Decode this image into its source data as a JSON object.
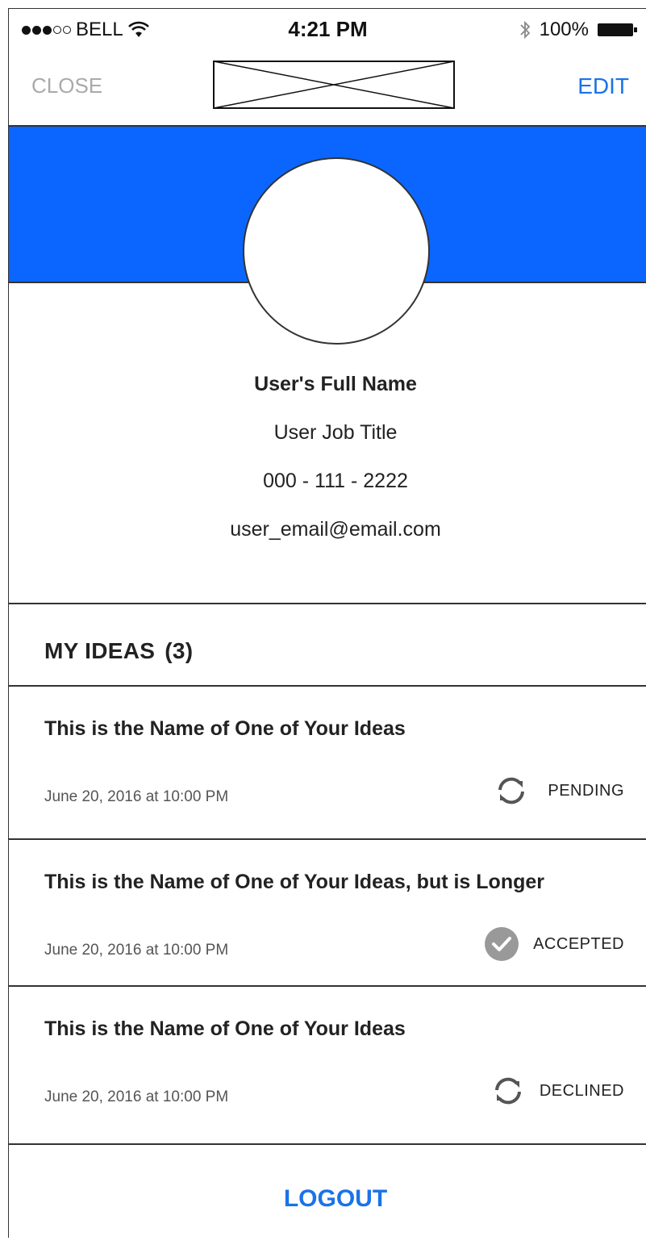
{
  "status_bar": {
    "carrier": "BELL",
    "time": "4:21 PM",
    "battery": "100%",
    "icons": [
      "signal-dots-icon",
      "wifi-icon",
      "bluetooth-icon",
      "battery-icon"
    ]
  },
  "nav": {
    "close_label": "CLOSE",
    "edit_label": "EDIT",
    "logo": "image-placeholder-icon"
  },
  "colors": {
    "banner": "#0b66ff",
    "accent": "#1a73e8",
    "close": "#aaaaaa"
  },
  "profile": {
    "name": "User's Full Name",
    "job_title": "User Job Title",
    "phone": "000 - 111 - 2222",
    "email": "user_email@email.com"
  },
  "ideas_section": {
    "title": "MY IDEAS",
    "count": "(3)"
  },
  "ideas": [
    {
      "title": "This is the Name of One of Your Ideas",
      "date": "June 20, 2016 at 10:00 PM",
      "status": "PENDING",
      "icon": "refresh-icon"
    },
    {
      "title": "This is the Name of One of Your Ideas, but is Longer",
      "date": "June 20, 2016 at 10:00 PM",
      "status": "ACCEPTED",
      "icon": "check-circle-icon"
    },
    {
      "title": "This is the Name of One of Your Ideas",
      "date": "June 20, 2016 at 10:00 PM",
      "status": "DECLINED",
      "icon": "refresh-icon"
    }
  ],
  "logout_label": "LOGOUT"
}
